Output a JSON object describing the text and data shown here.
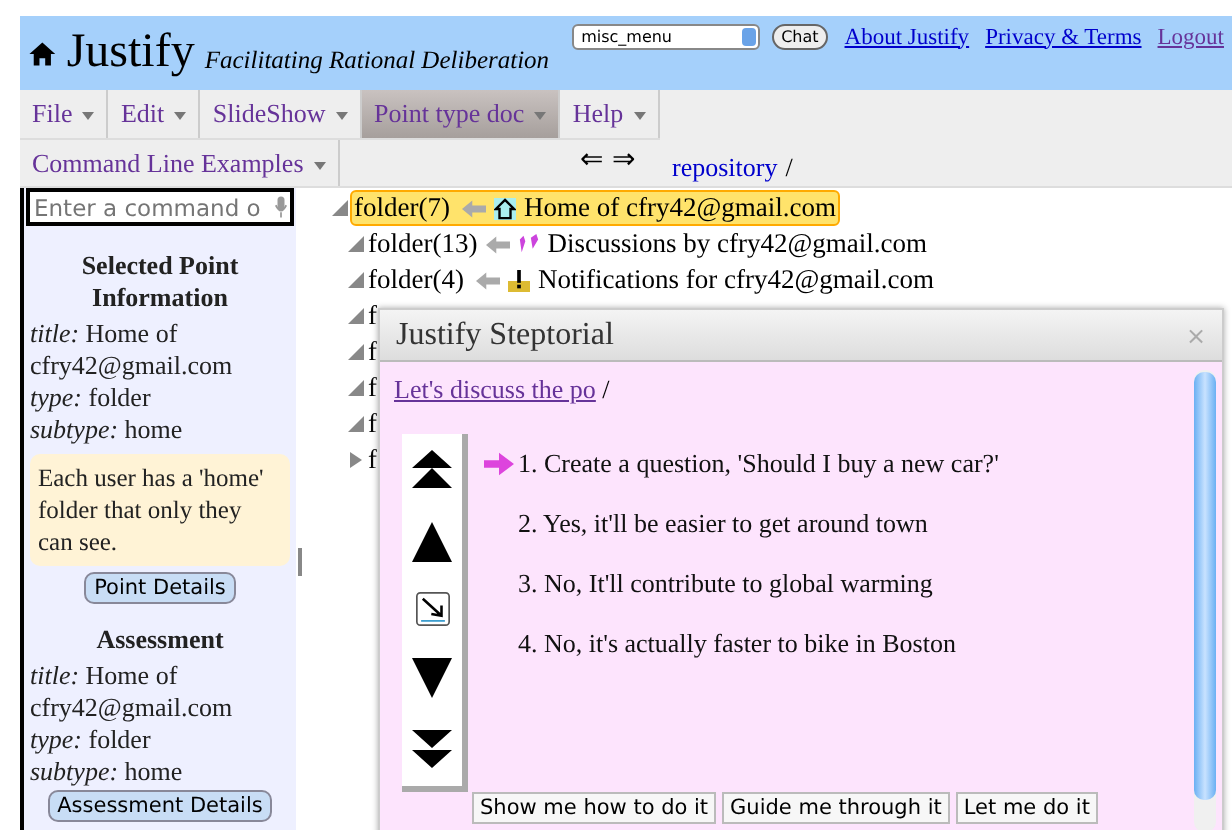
{
  "header": {
    "title": "Justify",
    "subtitle": "Facilitating Rational Deliberation",
    "menu_select": "misc_menu",
    "chat_button": "Chat",
    "links": [
      {
        "label": "About Justify",
        "visited": false
      },
      {
        "label": "Privacy & Terms",
        "visited": false
      },
      {
        "label": "Logout",
        "visited": true
      }
    ]
  },
  "menubar": [
    {
      "label": "File",
      "selected": false
    },
    {
      "label": "Edit",
      "selected": false
    },
    {
      "label": "SlideShow",
      "selected": false
    },
    {
      "label": "Point type doc",
      "selected": true
    },
    {
      "label": "Help",
      "selected": false
    }
  ],
  "menubar2": [
    {
      "label": "Command Line Examples",
      "selected": false
    }
  ],
  "nav": {
    "back": "⇐",
    "forward": "⇒",
    "breadcrumb": "repository",
    "separator": "/"
  },
  "command": {
    "placeholder": "Enter a command o"
  },
  "sidebar": {
    "point_heading": "Selected Point Information",
    "point_fields": [
      {
        "key": "title:",
        "value": "Home of cfry42@gmail.com"
      },
      {
        "key": "type:",
        "value": "folder"
      },
      {
        "key": "subtype:",
        "value": "home"
      }
    ],
    "note": "Each user has a 'home' folder that only they can see.",
    "point_button": "Point Details",
    "assessment_heading": "Assessment",
    "assessment_fields": [
      {
        "key": "title:",
        "value": "Home of cfry42@gmail.com"
      },
      {
        "key": "type:",
        "value": "folder"
      },
      {
        "key": "subtype:",
        "value": "home"
      }
    ],
    "assessment_button": "Assessment Details"
  },
  "tree": [
    {
      "type": "folder(7)",
      "label": "Home of cfry42@gmail.com",
      "kind": "home",
      "selected": true,
      "expanded": true
    },
    {
      "type": "folder(13)",
      "label": "Discussions by cfry42@gmail.com",
      "kind": "discussion",
      "selected": false,
      "expanded": true
    },
    {
      "type": "folder(4)",
      "label": "Notifications for cfry42@gmail.com",
      "kind": "notice",
      "selected": false,
      "expanded": true
    },
    {
      "type": "f",
      "selected": false,
      "expanded": true
    },
    {
      "type": "f",
      "selected": false,
      "expanded": true
    },
    {
      "type": "f",
      "selected": false,
      "expanded": true
    },
    {
      "type": "f",
      "selected": false,
      "expanded": true
    },
    {
      "type": "f",
      "selected": false,
      "expanded": false
    }
  ],
  "dialog": {
    "title": "Justify Steptorial",
    "close": "×",
    "link": "Let's discuss the po",
    "separator": "/",
    "steps": [
      {
        "text": "1. Create a question, 'Should I buy a new car?'",
        "current": true
      },
      {
        "text": "2. Yes, it'll be easier to get around town",
        "current": false
      },
      {
        "text": "3. No, It'll contribute to global warming",
        "current": false
      },
      {
        "text": "4. No, it's actually faster to bike in Boston",
        "current": false
      }
    ],
    "buttons": [
      "Show me how to do it",
      "Guide me through it",
      "Let me do it"
    ]
  }
}
